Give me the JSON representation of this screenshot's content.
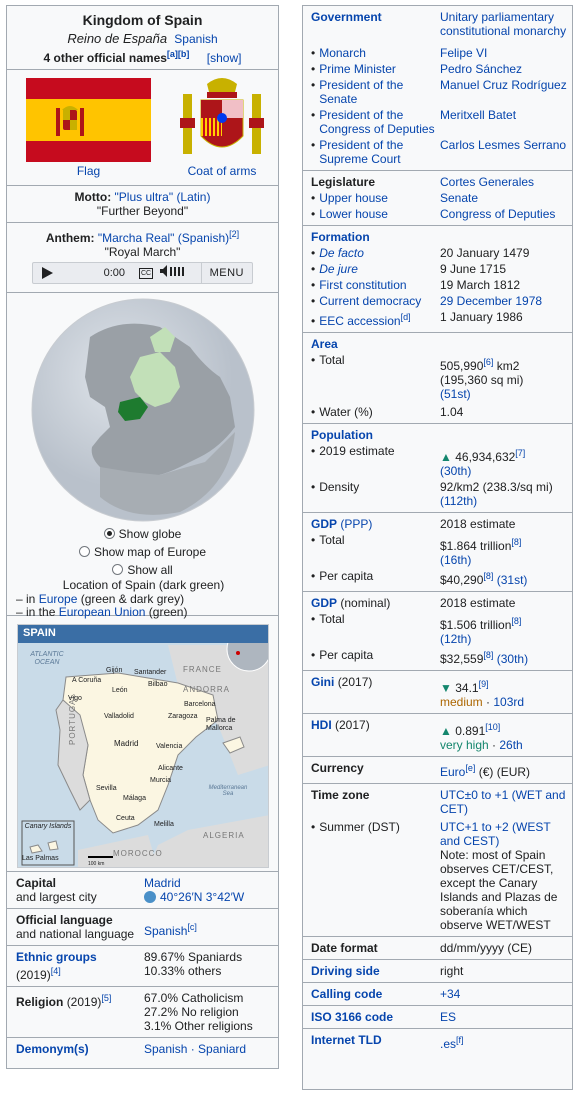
{
  "infobox": {
    "title": "Kingdom of Spain",
    "native_name": "Reino de España",
    "native_lang": "Spanish",
    "other_names": "4 other official names",
    "other_refs": "[a][b]",
    "show_label": "[show]"
  },
  "flag": {
    "caption": "Flag"
  },
  "arms": {
    "caption": "Coat of arms"
  },
  "motto": {
    "label": "Motto:",
    "text": "\"Plus ultra\"",
    "lang": "(Latin)",
    "translation": "\"Further Beyond\""
  },
  "anthem": {
    "label": "Anthem:",
    "text": "\"Marcha Real\"",
    "lang": "(Spanish)",
    "ref": "[2]",
    "translation": "\"Royal March\""
  },
  "player": {
    "time": "0:00",
    "cc": "CC",
    "menu": "MENU"
  },
  "globe": {
    "opt1": "Show globe",
    "opt2": "Show map of Europe",
    "opt3": "Show all",
    "caption": "Location of Spain (dark green)",
    "line2_pre": "– in ",
    "line2_link": "Europe",
    "line2_post": " (green & dark grey)",
    "line3_pre": "– in the ",
    "line3_link": "European Union",
    "line3_post": " (green)"
  },
  "map": {
    "title": "SPAIN",
    "labels": {
      "atlantic": "ATLANTIC OCEAN",
      "france": "FRANCE",
      "andorra": "ANDORRA",
      "portugal": "PORTUGAL",
      "morocco": "MOROCCO",
      "algeria": "ALGERIA",
      "med": "Mediterranean Sea",
      "canary": "Canary Islands",
      "laspalmas": "Las Palmas",
      "scale": "100 km"
    },
    "cities": [
      "Gijón",
      "Santander",
      "A Coruña",
      "Bilbao",
      "León",
      "Vigo",
      "Valladolid",
      "Zaragoza",
      "Barcelona",
      "Madrid",
      "Palma de Mallorca",
      "Valencia",
      "Alicante",
      "Murcia",
      "Sevilla",
      "Málaga",
      "Ceuta",
      "Melilla"
    ]
  },
  "left_rows": [
    {
      "k": "Capital",
      "k2": "and largest city",
      "v": "Madrid",
      "v2": "40°26′N 3°42′W"
    },
    {
      "k": "Official language",
      "k2": "and national language",
      "v": "Spanish",
      "vref": "[c]"
    },
    {
      "k": "Ethnic groups",
      "k2": "(2019)",
      "kref": "[4]",
      "v": "89.67% Spaniards",
      "v2": "10.33% others"
    },
    {
      "k": "Religion",
      "k2": "(2019)",
      "kref": "[5]",
      "v": "67.0% Catholicism",
      "v2": "27.2% No religion",
      "v3": "3.1% Other religions"
    },
    {
      "k": "Demonym(s)",
      "v": "Spanish · Spaniard"
    }
  ],
  "government": {
    "label": "Government",
    "value": "Unitary parliamentary constitutional monarchy",
    "rows": [
      {
        "k": "Monarch",
        "v": "Felipe VI"
      },
      {
        "k": "Prime Minister",
        "v": "Pedro Sánchez"
      },
      {
        "k": "President of the Senate",
        "v": "Manuel Cruz Rodríguez"
      },
      {
        "k": "President of the Congress of Deputies",
        "v": "Meritxell Batet"
      },
      {
        "k": "President of the Supreme Court",
        "v": "Carlos Lesmes Serrano"
      }
    ]
  },
  "legislature": {
    "label": "Legislature",
    "value": "Cortes Generales",
    "rows": [
      {
        "k": "Upper house",
        "v": "Senate"
      },
      {
        "k": "Lower house",
        "v": "Congress of Deputies"
      }
    ]
  },
  "formation": {
    "label": "Formation",
    "rows": [
      {
        "k": "De facto",
        "v": "20 January 1479"
      },
      {
        "k": "De jure",
        "v": "9 June 1715"
      },
      {
        "k": "First constitution",
        "v": "19 March 1812"
      },
      {
        "k": "Current democracy",
        "v": "29 December 1978"
      },
      {
        "k": "EEC accession",
        "kref": "[d]",
        "v": "1 January 1986"
      }
    ]
  },
  "area": {
    "label": "Area",
    "total_k": "Total",
    "total_v": "505,990",
    "total_ref": "[6]",
    "total_unit": "km2",
    "total_v2": "(195,360 sq mi)",
    "total_rank": "(51st)",
    "water_k": "Water (%)",
    "water_v": "1.04"
  },
  "population": {
    "label": "Population",
    "est_k": "2019 estimate",
    "est_v": "46,934,632",
    "est_ref": "[7]",
    "est_rank": "(30th)",
    "dens_k": "Density",
    "dens_v": "92/km2 (238.3/sq mi)",
    "dens_rank": "(112th)"
  },
  "gdp_ppp": {
    "label": "GDP",
    "label2": "(PPP)",
    "year": "2018 estimate",
    "total_k": "Total",
    "total_v": "$1.864 trillion",
    "total_ref": "[8]",
    "total_rank": "(16th)",
    "pc_k": "Per capita",
    "pc_v": "$40,290",
    "pc_ref": "[8]",
    "pc_rank": "(31st)"
  },
  "gdp_nom": {
    "label": "GDP",
    "label2": "(nominal)",
    "year": "2018 estimate",
    "total_k": "Total",
    "total_v": "$1.506 trillion",
    "total_ref": "[8]",
    "total_rank": "(12th)",
    "pc_k": "Per capita",
    "pc_v": "$32,559",
    "pc_ref": "[8]",
    "pc_rank": "(30th)"
  },
  "gini": {
    "label": "Gini",
    "year": "(2017)",
    "value": "34.1",
    "ref": "[9]",
    "level": "medium",
    "rank": "103rd"
  },
  "hdi": {
    "label": "HDI",
    "year": "(2017)",
    "value": "0.891",
    "ref": "[10]",
    "level": "very high",
    "rank": "26th"
  },
  "currency": {
    "label": "Currency",
    "value": "Euro",
    "ref": "[e]",
    "rest": "(€) (EUR)"
  },
  "timezone": {
    "label": "Time zone",
    "value": "UTC±0 to +1 (WET and CET)",
    "summer_k": "Summer (DST)",
    "summer_v": "UTC+1 to +2 (WEST and CEST)",
    "note": "Note: most of Spain observes CET/CEST, except the Canary Islands and Plazas de soberanía which observe WET/WEST"
  },
  "date": {
    "label": "Date format",
    "value": "dd/mm/yyyy (CE)"
  },
  "driving": {
    "label": "Driving side",
    "value": "right"
  },
  "calling": {
    "label": "Calling code",
    "value": "+34"
  },
  "iso": {
    "label": "ISO 3166 code",
    "value": "ES"
  },
  "tld": {
    "label": "Internet TLD",
    "value": ".es",
    "ref": "[f]"
  },
  "colors": {
    "link": "#0645ad",
    "border": "#a2a9b1",
    "bg": "#f8f9fa",
    "up": "#14866d",
    "down": "#14866d",
    "orange": "#ac6600"
  }
}
